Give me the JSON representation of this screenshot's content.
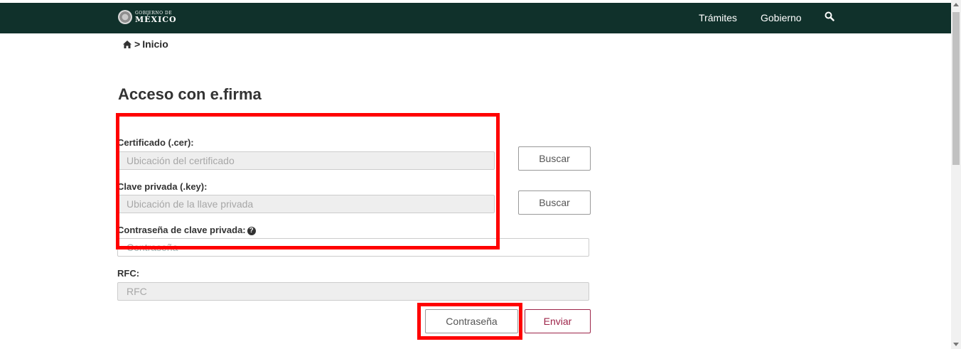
{
  "header": {
    "logo_small": "GOBIERNO DE",
    "logo_big": "MÉXICO",
    "nav": [
      "Trámites",
      "Gobierno"
    ],
    "search_icon": "search-icon",
    "bg_color": "#10312b"
  },
  "breadcrumb": {
    "home_icon": "home-icon",
    "separator": ">",
    "current": "Inicio"
  },
  "form": {
    "title": "Acceso con e.firma",
    "cert_label": "Certificado (.cer):",
    "cert_placeholder": "Ubicación del certificado",
    "key_label": "Clave privada (.key):",
    "key_placeholder": "Ubicación de la llave privada",
    "password_label": "Contraseña de clave privada:",
    "password_help_icon": "question-circle-icon",
    "password_placeholder": "Contraseña",
    "rfc_label": "RFC:",
    "rfc_placeholder": "RFC",
    "browse_label": "Buscar",
    "password_button": "Contraseña",
    "submit_button": "Enviar",
    "accent_color": "#9d2449"
  },
  "annotations": {
    "highlight_color": "#ff0000"
  }
}
